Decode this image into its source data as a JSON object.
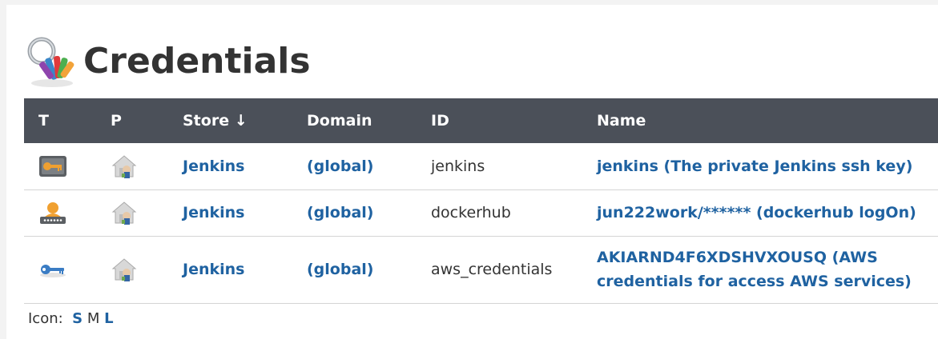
{
  "header": {
    "title": "Credentials",
    "title_icon": "credentials-keys-icon"
  },
  "table": {
    "columns": [
      "T",
      "P",
      "Store ↓",
      "Domain",
      "ID",
      "Name"
    ],
    "rows": [
      {
        "type_icon": "ssh-key-icon",
        "provider_icon": "jenkins-store-icon",
        "store": "Jenkins",
        "domain": "(global)",
        "id": "jenkins",
        "name": "jenkins (The private Jenkins ssh key)"
      },
      {
        "type_icon": "username-password-icon",
        "provider_icon": "jenkins-store-icon",
        "store": "Jenkins",
        "domain": "(global)",
        "id": "dockerhub",
        "name": "jun222work/****** (dockerhub logOn)"
      },
      {
        "type_icon": "aws-key-icon",
        "provider_icon": "jenkins-store-icon",
        "store": "Jenkins",
        "domain": "(global)",
        "id": "aws_credentials",
        "name": "AKIARND4F6XDSHVXOUSQ (AWS credentials for access AWS services)"
      }
    ]
  },
  "footer": {
    "icon_label": "Icon:",
    "sizes": [
      "S",
      "M",
      "L"
    ],
    "current_size": "M"
  },
  "colors": {
    "header_bg": "#4b5059",
    "link": "#1f62a1",
    "row_border": "#d4d4d4"
  }
}
